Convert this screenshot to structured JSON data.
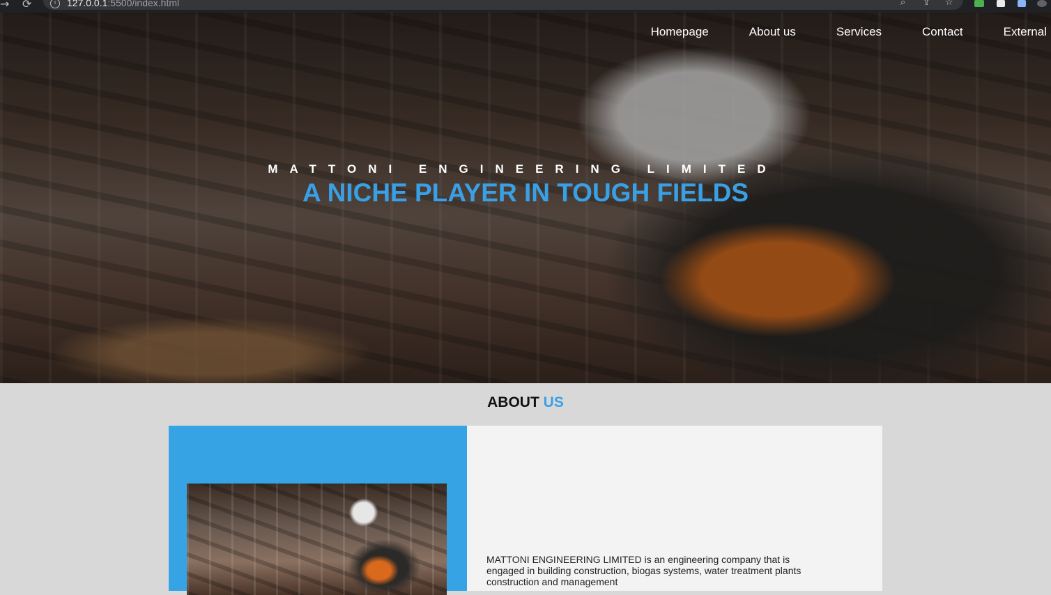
{
  "browser": {
    "url_host": "127.0.0.1",
    "url_rest": ":5500/index.html"
  },
  "nav": {
    "items": [
      {
        "label": "Homepage"
      },
      {
        "label": "About us"
      },
      {
        "label": "Services"
      },
      {
        "label": "Contact"
      },
      {
        "label": "External"
      }
    ]
  },
  "hero": {
    "company": "MATTONI ENGINEERING LIMITED",
    "tagline": "A NICHE PLAYER IN TOUGH FIELDS"
  },
  "about": {
    "heading_main": "ABOUT",
    "heading_accent": "US",
    "description": "MATTONI ENGINEERING LIMITED is an engineering company that is engaged in building construction, biogas systems, water treatment plants construction and management"
  },
  "colors": {
    "accent_blue": "#36a3e5",
    "section_bg": "#d8d8d8",
    "card_bg": "#f3f3f3"
  }
}
